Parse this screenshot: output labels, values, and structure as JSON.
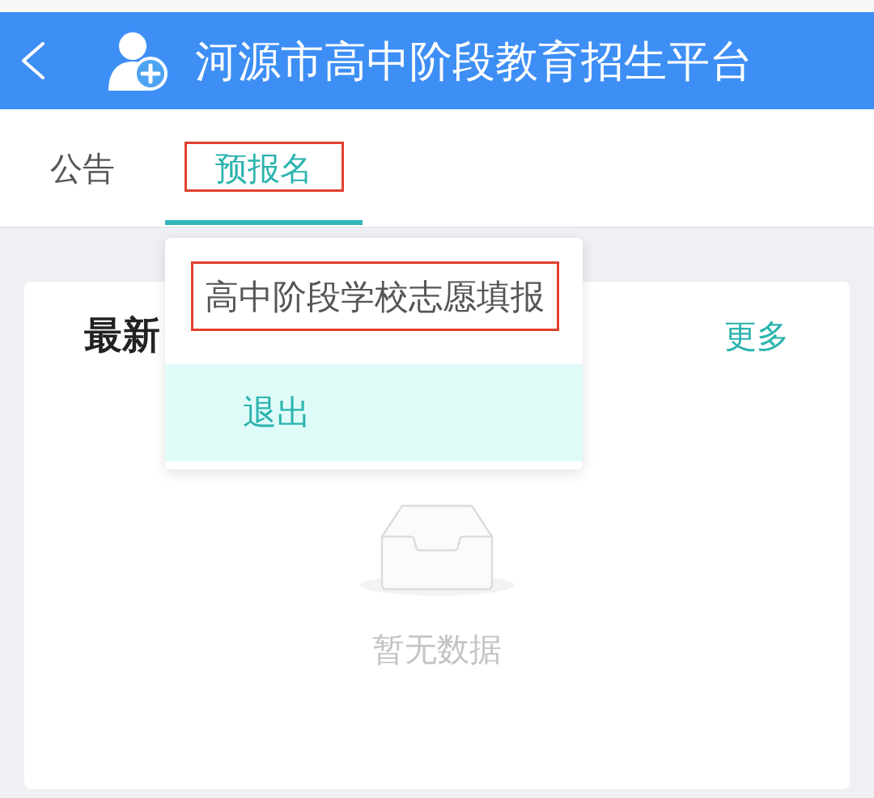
{
  "header": {
    "title": "河源市高中阶段教育招生平台"
  },
  "tabs": [
    {
      "label": "公告",
      "selected": false,
      "annotated": false
    },
    {
      "label": "预报名",
      "selected": true,
      "annotated": true
    }
  ],
  "card": {
    "title": "最新",
    "more_link": "更多",
    "empty_text": "暂无数据"
  },
  "dropdown": {
    "items": [
      {
        "label": "高中阶段学校志愿填报",
        "kind": "entry",
        "selected": false,
        "annotated": true
      },
      {
        "label": "退出",
        "kind": "exit",
        "selected": true,
        "annotated": false
      }
    ]
  }
}
